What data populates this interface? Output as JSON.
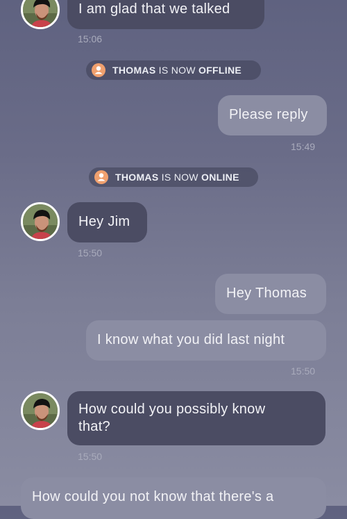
{
  "contact": {
    "name": "THOMAS"
  },
  "messages": [
    {
      "text": "I am glad that we talked",
      "time": "15:06"
    },
    {
      "text": "Please reply",
      "time": "15:49"
    },
    {
      "text": "Hey Jim",
      "time": "15:50"
    },
    {
      "text": "Hey Thomas"
    },
    {
      "text": "I know what you did last night",
      "time": "15:50"
    },
    {
      "text_line1": "How could you possibly know",
      "text_line2": "that?",
      "time": "15:50"
    },
    {
      "text": "How could you not know that there's a"
    }
  ],
  "status_events": [
    {
      "name": "THOMAS",
      "middle": "IS NOW",
      "state": "OFFLINE"
    },
    {
      "name": "THOMAS",
      "middle": "IS NOW",
      "state": "ONLINE"
    }
  ],
  "icons": {
    "status_user": "user-icon",
    "avatar": "contact-avatar"
  },
  "colors": {
    "incoming_bubble": "#4b4c63",
    "outgoing_bubble": "#8b8da3",
    "status_icon": "#f0a06e"
  }
}
